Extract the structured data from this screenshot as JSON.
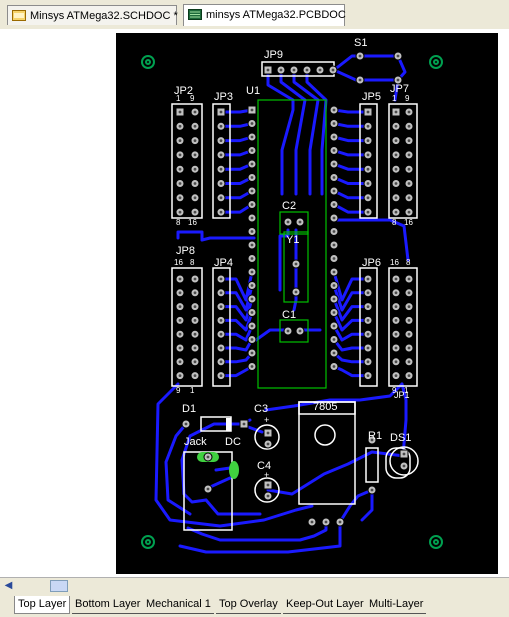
{
  "tabs": [
    {
      "label": "Minsys ATMega32.SCHDOC *",
      "icon": "schematic-doc-icon",
      "active": false
    },
    {
      "label": "minsys ATMega32.PCBDOC",
      "icon": "pcb-doc-icon",
      "active": true
    }
  ],
  "board": {
    "designators": {
      "jp9": "JP9",
      "s1": "S1",
      "jp2": "JP2",
      "jp3": "JP3",
      "u1": "U1",
      "jp5": "JP5",
      "jp7": "JP7",
      "c2": "C2",
      "y1": "Y1",
      "jp8": "JP8",
      "jp4": "JP4",
      "jp6": "JP6",
      "c1": "C1",
      "d1": "D1",
      "c3": "C3",
      "reg": "7805",
      "r1": "R1",
      "ds1": "DS1",
      "jack": "Jack",
      "dc": "DC",
      "c4": "C4"
    },
    "pin_numbers": {
      "jp2_top_a": "1",
      "jp2_top_b": "9",
      "jp2_bot_a": "8",
      "jp2_bot_b": "16",
      "jp7_top_a": "1",
      "jp7_top_b": "9",
      "jp7_bot_a": "8",
      "jp7_bot_b": "16",
      "jp8_top_a": "16",
      "jp8_top_b": "8",
      "jp8_bot_a": "9",
      "jp8_bot_b": "1",
      "jp6_top_a": "16",
      "jp6_top_b": "8",
      "jp6_bot_a": "9",
      "jp6_bot_b": "1",
      "c3_plus": "+",
      "c4_plus": "+",
      "jp1": "JP1"
    }
  },
  "layers": [
    "Top Layer",
    "Bottom Layer",
    "Mechanical 1",
    "Top Overlay",
    "Keep-Out Layer",
    "Multi-Layer"
  ],
  "active_layer": "Top Layer",
  "colors": {
    "board": "#000000",
    "bottom_trace": "#1a1aff",
    "overlay": "#ffffff",
    "pad": "#c0c0c0",
    "mounting_hole": "#00a050",
    "courtyard": "#00c000",
    "led_lead": "#40d040"
  }
}
